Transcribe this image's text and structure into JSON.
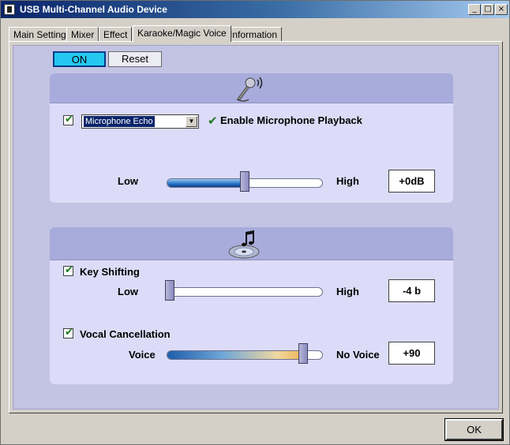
{
  "window": {
    "title": "USB Multi-Channel Audio Device",
    "buttons": {
      "minimize": "_",
      "maximize": "□",
      "close": "×"
    }
  },
  "tabs": [
    {
      "label": "Main Setting"
    },
    {
      "label": "Mixer"
    },
    {
      "label": "Effect"
    },
    {
      "label": "Karaoke/Magic Voice",
      "active": true
    },
    {
      "label": "Information"
    }
  ],
  "controls": {
    "on_label": "ON",
    "reset_label": "Reset"
  },
  "microphone": {
    "icon": "microphone-icon",
    "enabled": true,
    "effect_select": {
      "value": "Microphone Echo"
    },
    "playback_label": "Enable Microphone Playback",
    "playback_check": "✔",
    "low_label": "Low",
    "high_label": "High",
    "level_value": "+0dB",
    "level_fraction": 0.5
  },
  "music": {
    "icon": "music-cd-icon",
    "key_shifting": {
      "checked": true,
      "label": "Key Shifting",
      "low_label": "Low",
      "high_label": "High",
      "value": "-4 b",
      "level_fraction": 0.0
    },
    "vocal_cancellation": {
      "checked": true,
      "label": "Vocal Cancellation",
      "low_label": "Voice",
      "high_label": "No Voice",
      "value": "+90",
      "level_fraction": 0.88
    }
  },
  "footer": {
    "ok_label": "OK"
  },
  "colors": {
    "on_button": "#24c8f0",
    "panel_bg": "#dcdcf8",
    "panel_header": "#a8acdc",
    "check": "#1b7a1b"
  }
}
